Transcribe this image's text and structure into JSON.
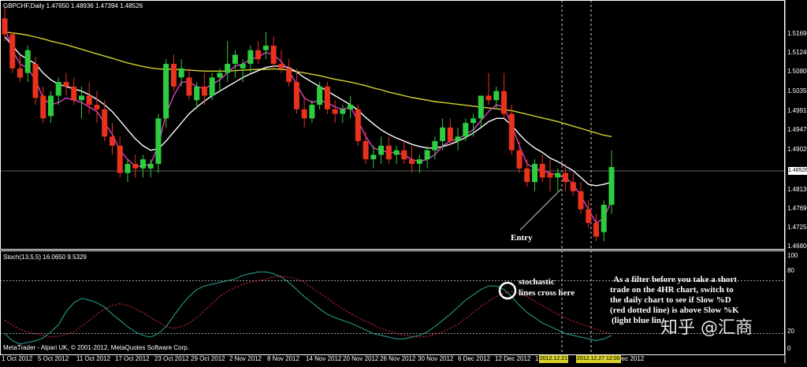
{
  "window": {
    "header_info": "GBPCHF,Daily  1.47650 1.48936 1.47394 1.48526",
    "indicator_info": "Stoch(13,5,5) 16.0650 9.5329",
    "footer": "MetaTrader - Alpari UK, © 2001-2012, MetaQuotes Software Corp."
  },
  "price_axis": {
    "ticks": [
      "1.51690",
      "1.51240",
      "1.50800",
      "1.50350",
      "1.49910",
      "1.49470",
      "1.49020",
      "1.48130",
      "1.47690",
      "1.47250",
      "1.46800"
    ],
    "current_label": "1.48526"
  },
  "stoch_axis": {
    "ticks": [
      "100",
      "80",
      "20",
      "0"
    ]
  },
  "time_axis": {
    "ticks": [
      "1 Oct 2012",
      "5 Oct 2012",
      "11 Oct 2012",
      "17 Oct 2012",
      "23 Oct 2012",
      "29 Oct 2012",
      "2 Nov 2012",
      "8 Nov 2012",
      "14 Nov 2012",
      "20 Nov 2012",
      "26 Nov 2012",
      "30 Nov 2012",
      "6 Dec 2012",
      "12 Dec 2012",
      "18",
      "Dec 2012"
    ],
    "highlighted": [
      "2012.12.21",
      "2012.12.27 12:00"
    ]
  },
  "annotations": {
    "entry": "Entry",
    "stoch_cross_1": "stochastic",
    "stoch_cross_2": "lines cross here",
    "filter_note_1": "As a filter before you take a short",
    "filter_note_2": "trade on the 4HR chart, switch to",
    "filter_note_3": "the daily chart to see  if Slow %D",
    "filter_note_4": "(red dotted line) is above Slow %K",
    "filter_note_5": "(light blue lin",
    "watermark": "知乎 @汇商"
  },
  "colors": {
    "background": "#000000",
    "bull": "#2ecc40",
    "bear": "#e8321e",
    "ma_fast": "#e040c8",
    "ma_mid": "#ffffff",
    "ma_slow": "#d4d430",
    "stoch_k": "#2aa898",
    "stoch_d": "#e0303a",
    "grid": "#ffffff"
  },
  "chart_data": {
    "type": "candlestick",
    "symbol": "GBPCHF",
    "timeframe": "Daily",
    "ylim": [
      1.468,
      1.521
    ],
    "candles": [
      [
        1.518,
        1.5205,
        1.513,
        1.5145
      ],
      [
        1.5145,
        1.515,
        1.506,
        1.507
      ],
      [
        1.507,
        1.51,
        1.504,
        1.505
      ],
      [
        1.506,
        1.512,
        1.504,
        1.511
      ],
      [
        1.508,
        1.5095,
        1.499,
        1.5005
      ],
      [
        1.501,
        1.503,
        1.495,
        1.496
      ],
      [
        1.4965,
        1.502,
        1.495,
        1.501
      ],
      [
        1.501,
        1.505,
        1.499,
        1.504
      ],
      [
        1.504,
        1.506,
        1.501,
        1.503
      ],
      [
        1.503,
        1.505,
        1.499,
        1.5
      ],
      [
        1.5,
        1.503,
        1.496,
        1.501
      ],
      [
        1.501,
        1.504,
        1.497,
        1.499
      ],
      [
        1.499,
        1.502,
        1.495,
        1.498
      ],
      [
        1.498,
        1.5,
        1.491,
        1.492
      ],
      [
        1.492,
        1.495,
        1.488,
        1.49
      ],
      [
        1.49,
        1.492,
        1.483,
        1.484
      ],
      [
        1.484,
        1.487,
        1.482,
        1.486
      ],
      [
        1.486,
        1.488,
        1.483,
        1.485
      ],
      [
        1.485,
        1.488,
        1.483,
        1.487
      ],
      [
        1.485,
        1.487,
        1.483,
        1.486
      ],
      [
        1.486,
        1.497,
        1.484,
        1.496
      ],
      [
        1.496,
        1.509,
        1.494,
        1.508
      ],
      [
        1.508,
        1.51,
        1.502,
        1.503
      ],
      [
        1.505,
        1.509,
        1.503,
        1.507
      ],
      [
        1.505,
        1.507,
        1.5,
        1.501
      ],
      [
        1.5,
        1.504,
        1.498,
        1.503
      ],
      [
        1.503,
        1.506,
        1.499,
        1.501
      ],
      [
        1.501,
        1.506,
        1.5,
        1.505
      ],
      [
        1.505,
        1.507,
        1.502,
        1.506
      ],
      [
        1.506,
        1.513,
        1.504,
        1.508
      ],
      [
        1.508,
        1.511,
        1.505,
        1.51
      ],
      [
        1.507,
        1.509,
        1.504,
        1.508
      ],
      [
        1.508,
        1.512,
        1.506,
        1.511
      ],
      [
        1.511,
        1.513,
        1.508,
        1.509
      ],
      [
        1.511,
        1.515,
        1.509,
        1.512
      ],
      [
        1.512,
        1.514,
        1.507,
        1.508
      ],
      [
        1.508,
        1.511,
        1.506,
        1.507
      ],
      [
        1.507,
        1.509,
        1.503,
        1.504
      ],
      [
        1.504,
        1.507,
        1.497,
        1.498
      ],
      [
        1.498,
        1.501,
        1.494,
        1.496
      ],
      [
        1.496,
        1.5,
        1.495,
        1.499
      ],
      [
        1.499,
        1.504,
        1.498,
        1.503
      ],
      [
        1.503,
        1.504,
        1.497,
        1.498
      ],
      [
        1.498,
        1.5,
        1.495,
        1.497
      ],
      [
        1.497,
        1.499,
        1.495,
        1.498
      ],
      [
        1.498,
        1.501,
        1.496,
        1.499
      ],
      [
        1.498,
        1.499,
        1.49,
        1.491
      ],
      [
        1.491,
        1.493,
        1.486,
        1.487
      ],
      [
        1.487,
        1.49,
        1.485,
        1.488
      ],
      [
        1.488,
        1.492,
        1.486,
        1.49
      ],
      [
        1.49,
        1.492,
        1.486,
        1.487
      ],
      [
        1.488,
        1.49,
        1.486,
        1.489
      ],
      [
        1.489,
        1.491,
        1.486,
        1.487
      ],
      [
        1.487,
        1.49,
        1.484,
        1.486
      ],
      [
        1.486,
        1.488,
        1.484,
        1.487
      ],
      [
        1.487,
        1.49,
        1.485,
        1.489
      ],
      [
        1.489,
        1.492,
        1.487,
        1.491
      ],
      [
        1.491,
        1.496,
        1.489,
        1.494
      ],
      [
        1.494,
        1.496,
        1.49,
        1.491
      ],
      [
        1.491,
        1.494,
        1.489,
        1.492
      ],
      [
        1.492,
        1.496,
        1.491,
        1.495
      ],
      [
        1.495,
        1.497,
        1.492,
        1.496
      ],
      [
        1.496,
        1.5,
        1.494,
        1.501
      ],
      [
        1.501,
        1.506,
        1.499,
        1.5
      ],
      [
        1.5,
        1.503,
        1.498,
        1.502
      ],
      [
        1.502,
        1.506,
        1.496,
        1.497
      ],
      [
        1.497,
        1.499,
        1.488,
        1.489
      ],
      [
        1.489,
        1.491,
        1.484,
        1.485
      ],
      [
        1.485,
        1.487,
        1.481,
        1.482
      ],
      [
        1.482,
        1.487,
        1.48,
        1.486
      ],
      [
        1.486,
        1.488,
        1.482,
        1.483
      ],
      [
        1.484,
        1.487,
        1.48,
        1.483
      ],
      [
        1.483,
        1.485,
        1.48,
        1.484
      ],
      [
        1.484,
        1.486,
        1.48,
        1.482
      ],
      [
        1.482,
        1.484,
        1.479,
        1.48
      ],
      [
        1.48,
        1.482,
        1.475,
        1.476
      ],
      [
        1.476,
        1.478,
        1.472,
        1.473
      ],
      [
        1.473,
        1.475,
        1.469,
        1.47
      ],
      [
        1.471,
        1.478,
        1.469,
        1.477
      ],
      [
        1.477,
        1.489,
        1.475,
        1.4853
      ]
    ],
    "series": [
      {
        "name": "ma_fast",
        "values": [
          1.516,
          1.511,
          1.508,
          1.507,
          1.5045,
          1.5005,
          1.499,
          1.4995,
          1.5005,
          1.5,
          1.4995,
          1.4985,
          1.4975,
          1.495,
          1.4925,
          1.489,
          1.487,
          1.4855,
          1.4855,
          1.486,
          1.49,
          1.497,
          1.501,
          1.504,
          1.504,
          1.503,
          1.5025,
          1.5035,
          1.5045,
          1.506,
          1.5075,
          1.508,
          1.509,
          1.5095,
          1.5105,
          1.51,
          1.5085,
          1.5065,
          1.5035,
          1.5005,
          1.4995,
          1.5,
          1.4995,
          1.4985,
          1.498,
          1.4985,
          1.4955,
          1.492,
          1.4895,
          1.489,
          1.4885,
          1.4885,
          1.488,
          1.487,
          1.4865,
          1.487,
          1.488,
          1.49,
          1.491,
          1.4915,
          1.4925,
          1.4935,
          1.4955,
          1.4975,
          1.499,
          1.4985,
          1.4945,
          1.49,
          1.486,
          1.485,
          1.4845,
          1.484,
          1.4835,
          1.483,
          1.4815,
          1.479,
          1.476,
          1.473,
          1.474,
          1.478
        ]
      },
      {
        "name": "ma_mid",
        "values": [
          1.514,
          1.512,
          1.51,
          1.509,
          1.508,
          1.506,
          1.5045,
          1.5035,
          1.503,
          1.5025,
          1.502,
          1.5012,
          1.5002,
          1.499,
          1.4975,
          1.4955,
          1.4935,
          1.4915,
          1.49,
          1.489,
          1.4893,
          1.491,
          1.493,
          1.495,
          1.497,
          1.4985,
          1.4998,
          1.501,
          1.502,
          1.503,
          1.504,
          1.505,
          1.5058,
          1.5065,
          1.5072,
          1.5075,
          1.5075,
          1.5072,
          1.5062,
          1.505,
          1.504,
          1.503,
          1.502,
          1.501,
          1.5,
          1.499,
          1.4978,
          1.4962,
          1.4948,
          1.4935,
          1.4925,
          1.4917,
          1.491,
          1.4903,
          1.4898,
          1.4895,
          1.4895,
          1.4898,
          1.4903,
          1.491,
          1.4918,
          1.4928,
          1.494,
          1.4953,
          1.496,
          1.496,
          1.4945,
          1.4925,
          1.4908,
          1.4895,
          1.4885,
          1.4873,
          1.4865,
          1.4855,
          1.4845,
          1.483,
          1.4815,
          1.4812,
          1.4815,
          1.482
        ]
      },
      {
        "name": "ma_slow",
        "values": [
          1.515,
          1.5148,
          1.5146,
          1.5143,
          1.5139,
          1.5135,
          1.513,
          1.5126,
          1.5122,
          1.5117,
          1.5112,
          1.5107,
          1.5102,
          1.5097,
          1.5092,
          1.5087,
          1.5082,
          1.5078,
          1.5074,
          1.5071,
          1.5069,
          1.5068,
          1.5068,
          1.5067,
          1.5066,
          1.5065,
          1.5064,
          1.5064,
          1.5064,
          1.5064,
          1.5065,
          1.5066,
          1.5067,
          1.5068,
          1.5068,
          1.5069,
          1.5068,
          1.5066,
          1.5063,
          1.506,
          1.5057,
          1.5054,
          1.505,
          1.5046,
          1.5043,
          1.504,
          1.5036,
          1.5032,
          1.5027,
          1.5023,
          1.5018,
          1.5014,
          1.501,
          1.5006,
          1.5003,
          1.5,
          1.4997,
          1.4995,
          1.4993,
          1.4991,
          1.4989,
          1.4987,
          1.4985,
          1.4983,
          1.4981,
          1.4979,
          1.4977,
          1.4973,
          1.4969,
          1.4965,
          1.4961,
          1.4957,
          1.4953,
          1.4948,
          1.4943,
          1.4938,
          1.4933,
          1.4928,
          1.4923,
          1.492
        ]
      }
    ],
    "stochastic": {
      "ylim": [
        0,
        100
      ],
      "k": [
        20,
        12,
        8,
        10,
        12,
        15,
        22,
        30,
        45,
        55,
        60,
        58,
        55,
        50,
        42,
        35,
        28,
        22,
        18,
        16,
        20,
        28,
        40,
        52,
        62,
        70,
        74,
        76,
        78,
        80,
        82,
        86,
        88,
        90,
        90,
        88,
        84,
        78,
        70,
        62,
        55,
        48,
        42,
        38,
        35,
        32,
        28,
        24,
        20,
        18,
        16,
        14,
        14,
        16,
        18,
        22,
        28,
        35,
        42,
        50,
        58,
        64,
        70,
        74,
        74,
        70,
        62,
        52,
        44,
        38,
        32,
        28,
        24,
        20,
        18,
        16,
        14,
        12,
        14,
        18
      ],
      "d": [
        35,
        30,
        25,
        22,
        20,
        18,
        16,
        17,
        19,
        22,
        28,
        35,
        42,
        48,
        52,
        54,
        52,
        48,
        44,
        38,
        33,
        28,
        26,
        28,
        32,
        38,
        46,
        54,
        62,
        68,
        72,
        76,
        78,
        80,
        82,
        84,
        85,
        84,
        82,
        78,
        72,
        66,
        60,
        54,
        48,
        43,
        38,
        34,
        30,
        26,
        23,
        20,
        18,
        17,
        16,
        17,
        19,
        22,
        26,
        31,
        37,
        44,
        51,
        57,
        62,
        66,
        68,
        66,
        62,
        57,
        52,
        47,
        42,
        38,
        34,
        31,
        28,
        25,
        22,
        20
      ]
    }
  }
}
